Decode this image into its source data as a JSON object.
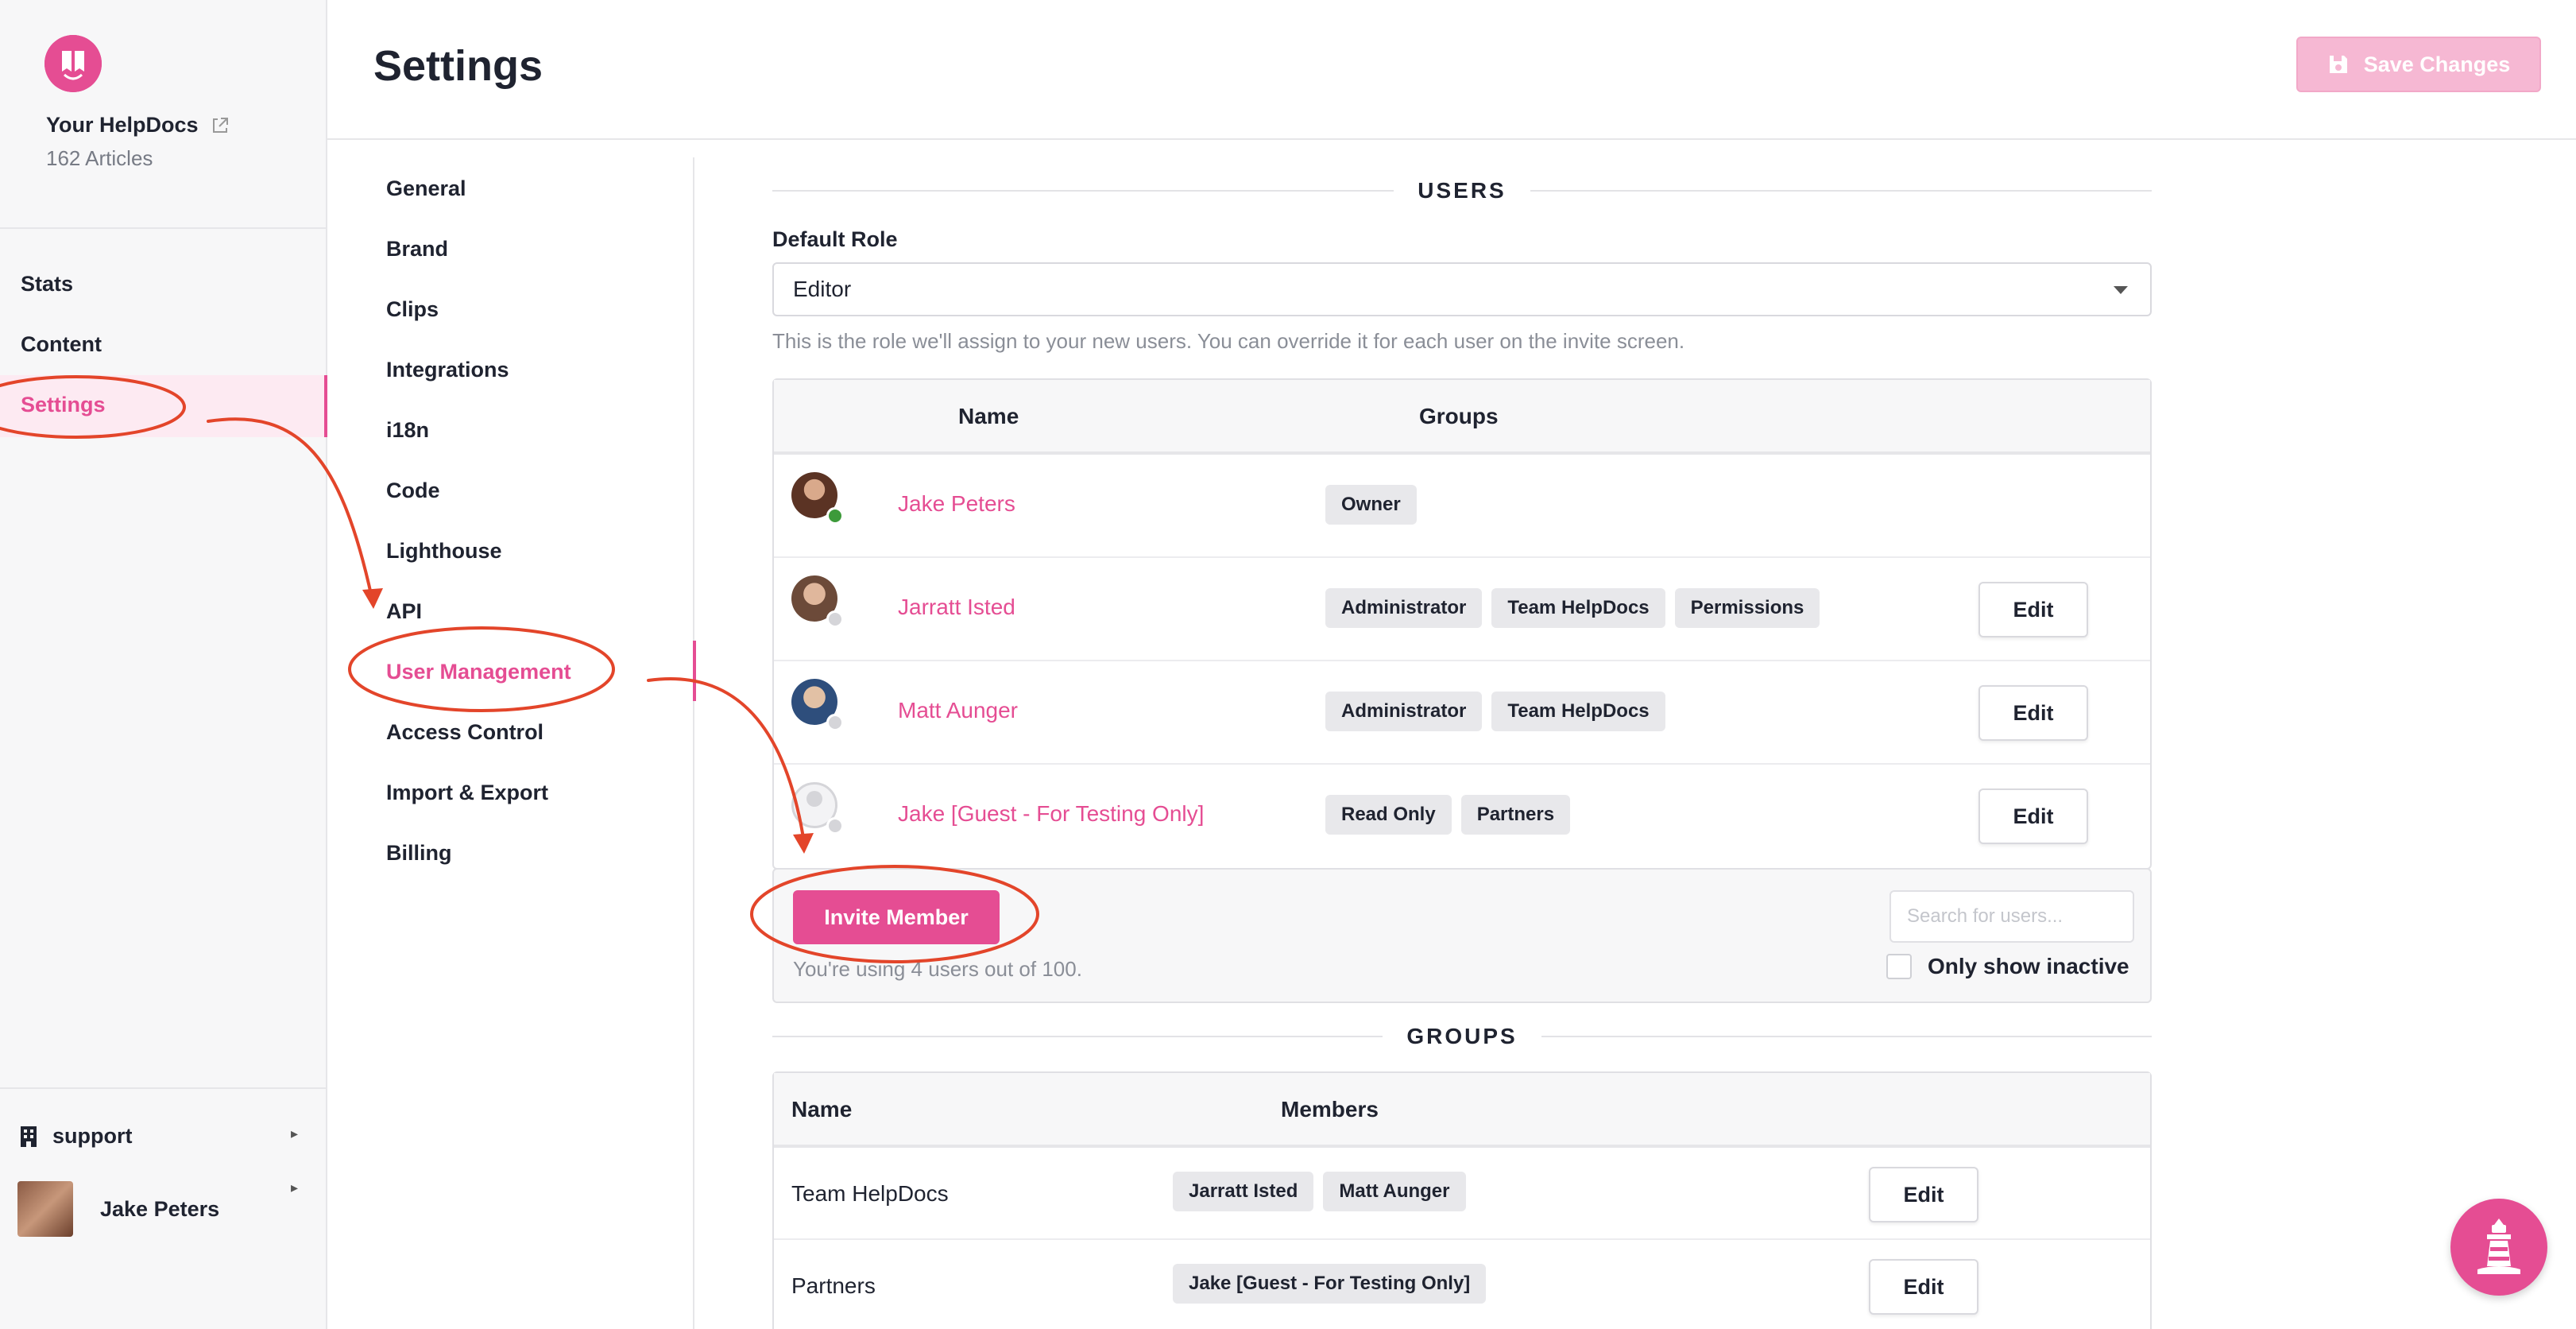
{
  "app": {
    "site_name": "Your HelpDocs",
    "article_count": "162 Articles",
    "page_title": "Settings",
    "save_label": "Save Changes",
    "accent_color": "#e54d93"
  },
  "sidebar": {
    "items": [
      {
        "label": "Stats"
      },
      {
        "label": "Content"
      },
      {
        "label": "Settings"
      }
    ],
    "org": "support",
    "user": "Jake Peters"
  },
  "subnav": {
    "items": [
      {
        "label": "General"
      },
      {
        "label": "Brand"
      },
      {
        "label": "Clips"
      },
      {
        "label": "Integrations"
      },
      {
        "label": "i18n"
      },
      {
        "label": "Code"
      },
      {
        "label": "Lighthouse"
      },
      {
        "label": "API"
      },
      {
        "label": "User Management"
      },
      {
        "label": "Access Control"
      },
      {
        "label": "Import & Export"
      },
      {
        "label": "Billing"
      }
    ]
  },
  "users": {
    "heading": "USERS",
    "default_role_label": "Default Role",
    "default_role_value": "Editor",
    "help_text": "This is the role we'll assign to your new users. You can override it for each user on the invite screen.",
    "col_name": "Name",
    "col_groups": "Groups",
    "rows": [
      {
        "name": "Jake Peters",
        "tags": [
          "Owner"
        ],
        "status": "online"
      },
      {
        "name": "Jarratt Isted",
        "tags": [
          "Administrator",
          "Team HelpDocs",
          "Permissions"
        ],
        "edit": "Edit",
        "status": "offline"
      },
      {
        "name": "Matt Aunger",
        "tags": [
          "Administrator",
          "Team HelpDocs"
        ],
        "edit": "Edit",
        "status": "offline"
      },
      {
        "name": "Jake [Guest - For Testing Only]",
        "tags": [
          "Read Only",
          "Partners"
        ],
        "edit": "Edit",
        "status": "offline"
      }
    ],
    "invite_label": "Invite Member",
    "usage_text": "You're using 4 users out of 100.",
    "search_placeholder": "Search for users...",
    "inactive_label": "Only show inactive"
  },
  "groups": {
    "heading": "GROUPS",
    "col_name": "Name",
    "col_members": "Members",
    "rows": [
      {
        "name": "Team HelpDocs",
        "members": [
          "Jarratt Isted",
          "Matt Aunger"
        ],
        "edit": "Edit"
      },
      {
        "name": "Partners",
        "members": [
          "Jake [Guest - For Testing Only]"
        ],
        "edit": "Edit"
      }
    ]
  },
  "annotation_color": "#e3452a"
}
